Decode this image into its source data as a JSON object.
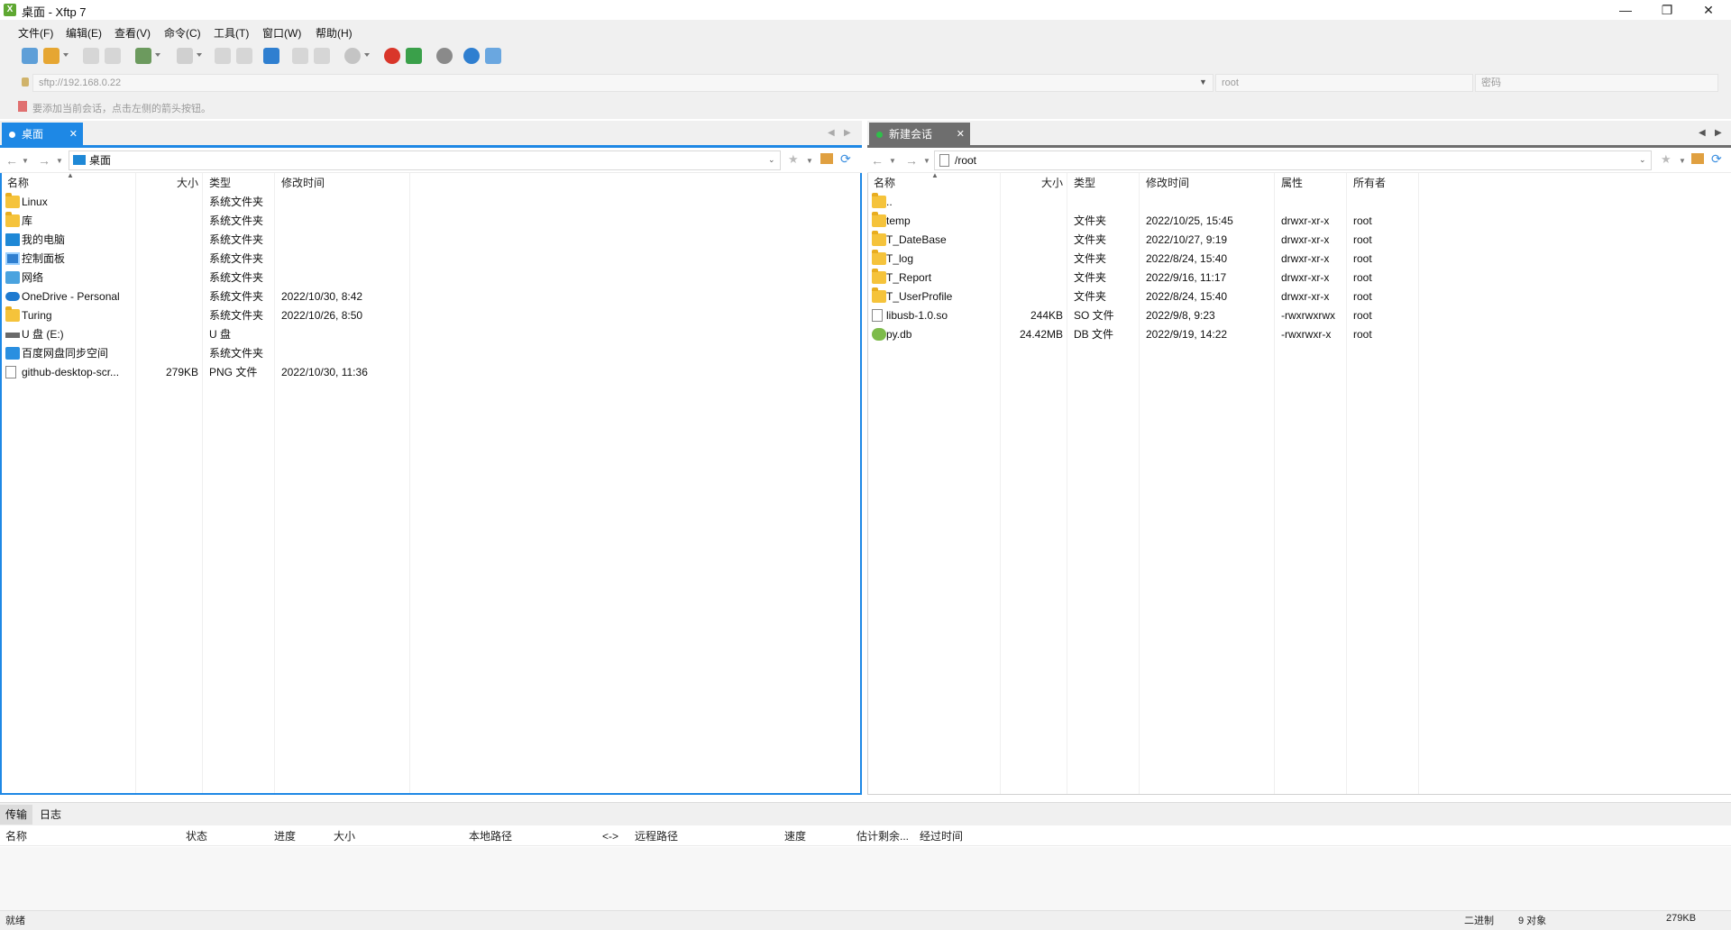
{
  "window": {
    "title": "桌面 - Xftp 7",
    "icon_text": "X"
  },
  "menu": [
    "文件(F)",
    "编辑(E)",
    "查看(V)",
    "命令(C)",
    "工具(T)",
    "窗口(W)",
    "帮助(H)"
  ],
  "address": {
    "host_placeholder": "sftp://192.168.0.22",
    "user_placeholder": "root",
    "password_placeholder": "密码"
  },
  "hint": "要添加当前会话，点击左侧的箭头按钮。",
  "left_pane": {
    "tab_label": "桌面",
    "path": "桌面",
    "columns": [
      "名称",
      "大小",
      "类型",
      "修改时间"
    ],
    "rows": [
      {
        "name": "Linux",
        "size": "",
        "type": "系统文件夹",
        "modified": "",
        "icon": "folder-icon"
      },
      {
        "name": "库",
        "size": "",
        "type": "系统文件夹",
        "modified": "",
        "icon": "folder-icon"
      },
      {
        "name": "我的电脑",
        "size": "",
        "type": "系统文件夹",
        "modified": "",
        "icon": "computer-icon"
      },
      {
        "name": "控制面板",
        "size": "",
        "type": "系统文件夹",
        "modified": "",
        "icon": "control-panel-icon"
      },
      {
        "name": "网络",
        "size": "",
        "type": "系统文件夹",
        "modified": "",
        "icon": "network-icon"
      },
      {
        "name": "OneDrive - Personal",
        "size": "",
        "type": "系统文件夹",
        "modified": "2022/10/30, 8:42",
        "icon": "cloud-icon"
      },
      {
        "name": "Turing",
        "size": "",
        "type": "系统文件夹",
        "modified": "2022/10/26, 8:50",
        "icon": "folder-icon"
      },
      {
        "name": "U 盘 (E:)",
        "size": "",
        "type": "U 盘",
        "modified": "",
        "icon": "usb-drive-icon"
      },
      {
        "name": "百度网盘同步空间",
        "size": "",
        "type": "系统文件夹",
        "modified": "",
        "icon": "baidu-cloud-icon"
      },
      {
        "name": "github-desktop-scr...",
        "size": "279KB",
        "type": "PNG 文件",
        "modified": "2022/10/30, 11:36",
        "icon": "file-icon"
      }
    ]
  },
  "right_pane": {
    "tab_label": "新建会话",
    "path": "/root",
    "columns": [
      "名称",
      "大小",
      "类型",
      "修改时间",
      "属性",
      "所有者"
    ],
    "rows": [
      {
        "name": "..",
        "size": "",
        "type": "",
        "modified": "",
        "attr": "",
        "owner": "",
        "icon": "folder-icon"
      },
      {
        "name": "temp",
        "size": "",
        "type": "文件夹",
        "modified": "2022/10/25, 15:45",
        "attr": "drwxr-xr-x",
        "owner": "root",
        "icon": "folder-icon"
      },
      {
        "name": "T_DateBase",
        "size": "",
        "type": "文件夹",
        "modified": "2022/10/27, 9:19",
        "attr": "drwxr-xr-x",
        "owner": "root",
        "icon": "folder-icon"
      },
      {
        "name": "T_log",
        "size": "",
        "type": "文件夹",
        "modified": "2022/8/24, 15:40",
        "attr": "drwxr-xr-x",
        "owner": "root",
        "icon": "folder-icon"
      },
      {
        "name": "T_Report",
        "size": "",
        "type": "文件夹",
        "modified": "2022/9/16, 11:17",
        "attr": "drwxr-xr-x",
        "owner": "root",
        "icon": "folder-icon"
      },
      {
        "name": "T_UserProfile",
        "size": "",
        "type": "文件夹",
        "modified": "2022/8/24, 15:40",
        "attr": "drwxr-xr-x",
        "owner": "root",
        "icon": "folder-icon"
      },
      {
        "name": "libusb-1.0.so",
        "size": "244KB",
        "type": "SO 文件",
        "modified": "2022/9/8, 9:23",
        "attr": "-rwxrwxrwx",
        "owner": "root",
        "icon": "file-icon"
      },
      {
        "name": "py.db",
        "size": "24.42MB",
        "type": "DB 文件",
        "modified": "2022/9/19, 14:22",
        "attr": "-rwxrwxr-x",
        "owner": "root",
        "icon": "database-icon"
      }
    ]
  },
  "transfer": {
    "tabs": [
      "传输",
      "日志"
    ],
    "columns": [
      "名称",
      "状态",
      "进度",
      "大小",
      "本地路径",
      "<->",
      "远程路径",
      "速度",
      "估计剩余...",
      "经过时间"
    ]
  },
  "status": {
    "ready": "就绪",
    "mode": "二进制",
    "objects": "9 对象",
    "size": "279KB"
  },
  "colors": {
    "accent_blue": "#1e88e5",
    "inactive_tab": "#6e6e6e",
    "folder": "#f5c33b"
  }
}
